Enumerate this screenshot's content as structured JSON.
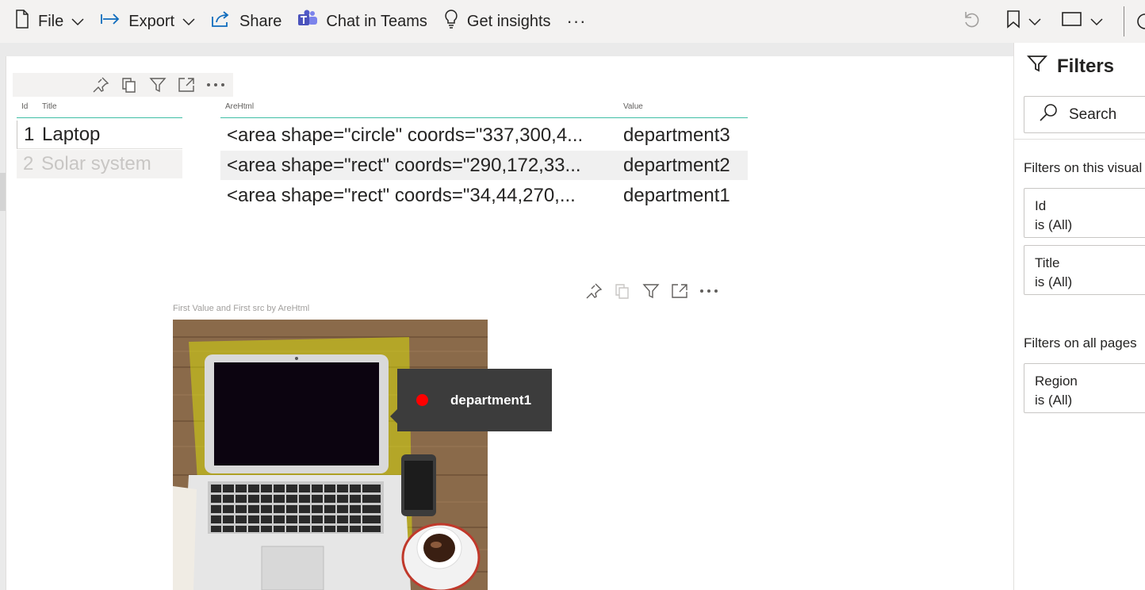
{
  "toolbar": {
    "file_label": "File",
    "export_label": "Export",
    "share_label": "Share",
    "teams_label": "Chat in Teams",
    "insights_label": "Get insights",
    "more_label": "···"
  },
  "table1": {
    "headers": [
      "Id",
      "Title"
    ],
    "rows": [
      {
        "id": "1",
        "title": "Laptop"
      },
      {
        "id": "2",
        "title": "Solar system"
      }
    ]
  },
  "table2": {
    "headers": [
      "AreHtml",
      "Value"
    ],
    "rows": [
      {
        "html": "<area shape=\"circle\" coords=\"337,300,4...",
        "value": "department3"
      },
      {
        "html": "<area shape=\"rect\" coords=\"290,172,33...",
        "value": "department2"
      },
      {
        "html": "<area shape=\"rect\" coords=\"34,44,270,...",
        "value": "department1"
      }
    ]
  },
  "image_visual": {
    "title": "First Value and First src by AreHtml"
  },
  "tooltip": {
    "label": "department1",
    "dot_color": "#ff0000"
  },
  "filters": {
    "title": "Filters",
    "search_placeholder": "Search",
    "section_visual": "Filters on this visual",
    "section_all_pages": "Filters on all pages",
    "cards_visual": [
      {
        "field": "Id",
        "state": "is (All)"
      },
      {
        "field": "Title",
        "state": "is (All)"
      }
    ],
    "cards_all_pages": [
      {
        "field": "Region",
        "state": "is (All)"
      }
    ]
  },
  "colors": {
    "accent_line": "#3fbfa5",
    "highlight_yellow": "#e6f000",
    "teams_purple": "#5059c9"
  }
}
